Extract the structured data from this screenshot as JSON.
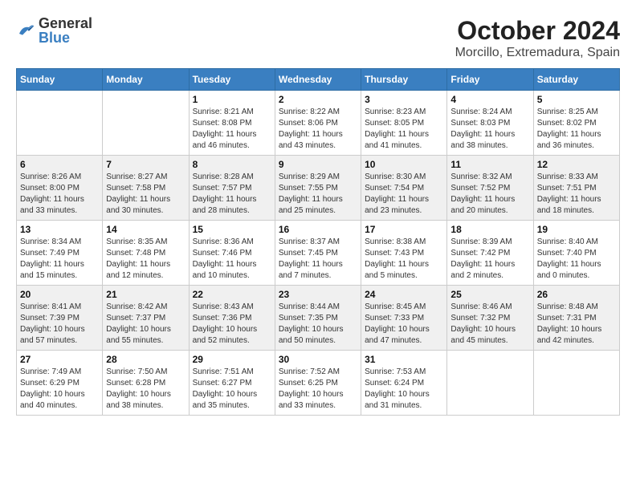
{
  "header": {
    "logo": {
      "general": "General",
      "blue": "Blue"
    },
    "title": "October 2024",
    "subtitle": "Morcillo, Extremadura, Spain"
  },
  "columns": [
    "Sunday",
    "Monday",
    "Tuesday",
    "Wednesday",
    "Thursday",
    "Friday",
    "Saturday"
  ],
  "weeks": [
    [
      {
        "day": "",
        "sunrise": "",
        "sunset": "",
        "daylight": ""
      },
      {
        "day": "",
        "sunrise": "",
        "sunset": "",
        "daylight": ""
      },
      {
        "day": "1",
        "sunrise": "Sunrise: 8:21 AM",
        "sunset": "Sunset: 8:08 PM",
        "daylight": "Daylight: 11 hours and 46 minutes."
      },
      {
        "day": "2",
        "sunrise": "Sunrise: 8:22 AM",
        "sunset": "Sunset: 8:06 PM",
        "daylight": "Daylight: 11 hours and 43 minutes."
      },
      {
        "day": "3",
        "sunrise": "Sunrise: 8:23 AM",
        "sunset": "Sunset: 8:05 PM",
        "daylight": "Daylight: 11 hours and 41 minutes."
      },
      {
        "day": "4",
        "sunrise": "Sunrise: 8:24 AM",
        "sunset": "Sunset: 8:03 PM",
        "daylight": "Daylight: 11 hours and 38 minutes."
      },
      {
        "day": "5",
        "sunrise": "Sunrise: 8:25 AM",
        "sunset": "Sunset: 8:02 PM",
        "daylight": "Daylight: 11 hours and 36 minutes."
      }
    ],
    [
      {
        "day": "6",
        "sunrise": "Sunrise: 8:26 AM",
        "sunset": "Sunset: 8:00 PM",
        "daylight": "Daylight: 11 hours and 33 minutes."
      },
      {
        "day": "7",
        "sunrise": "Sunrise: 8:27 AM",
        "sunset": "Sunset: 7:58 PM",
        "daylight": "Daylight: 11 hours and 30 minutes."
      },
      {
        "day": "8",
        "sunrise": "Sunrise: 8:28 AM",
        "sunset": "Sunset: 7:57 PM",
        "daylight": "Daylight: 11 hours and 28 minutes."
      },
      {
        "day": "9",
        "sunrise": "Sunrise: 8:29 AM",
        "sunset": "Sunset: 7:55 PM",
        "daylight": "Daylight: 11 hours and 25 minutes."
      },
      {
        "day": "10",
        "sunrise": "Sunrise: 8:30 AM",
        "sunset": "Sunset: 7:54 PM",
        "daylight": "Daylight: 11 hours and 23 minutes."
      },
      {
        "day": "11",
        "sunrise": "Sunrise: 8:32 AM",
        "sunset": "Sunset: 7:52 PM",
        "daylight": "Daylight: 11 hours and 20 minutes."
      },
      {
        "day": "12",
        "sunrise": "Sunrise: 8:33 AM",
        "sunset": "Sunset: 7:51 PM",
        "daylight": "Daylight: 11 hours and 18 minutes."
      }
    ],
    [
      {
        "day": "13",
        "sunrise": "Sunrise: 8:34 AM",
        "sunset": "Sunset: 7:49 PM",
        "daylight": "Daylight: 11 hours and 15 minutes."
      },
      {
        "day": "14",
        "sunrise": "Sunrise: 8:35 AM",
        "sunset": "Sunset: 7:48 PM",
        "daylight": "Daylight: 11 hours and 12 minutes."
      },
      {
        "day": "15",
        "sunrise": "Sunrise: 8:36 AM",
        "sunset": "Sunset: 7:46 PM",
        "daylight": "Daylight: 11 hours and 10 minutes."
      },
      {
        "day": "16",
        "sunrise": "Sunrise: 8:37 AM",
        "sunset": "Sunset: 7:45 PM",
        "daylight": "Daylight: 11 hours and 7 minutes."
      },
      {
        "day": "17",
        "sunrise": "Sunrise: 8:38 AM",
        "sunset": "Sunset: 7:43 PM",
        "daylight": "Daylight: 11 hours and 5 minutes."
      },
      {
        "day": "18",
        "sunrise": "Sunrise: 8:39 AM",
        "sunset": "Sunset: 7:42 PM",
        "daylight": "Daylight: 11 hours and 2 minutes."
      },
      {
        "day": "19",
        "sunrise": "Sunrise: 8:40 AM",
        "sunset": "Sunset: 7:40 PM",
        "daylight": "Daylight: 11 hours and 0 minutes."
      }
    ],
    [
      {
        "day": "20",
        "sunrise": "Sunrise: 8:41 AM",
        "sunset": "Sunset: 7:39 PM",
        "daylight": "Daylight: 10 hours and 57 minutes."
      },
      {
        "day": "21",
        "sunrise": "Sunrise: 8:42 AM",
        "sunset": "Sunset: 7:37 PM",
        "daylight": "Daylight: 10 hours and 55 minutes."
      },
      {
        "day": "22",
        "sunrise": "Sunrise: 8:43 AM",
        "sunset": "Sunset: 7:36 PM",
        "daylight": "Daylight: 10 hours and 52 minutes."
      },
      {
        "day": "23",
        "sunrise": "Sunrise: 8:44 AM",
        "sunset": "Sunset: 7:35 PM",
        "daylight": "Daylight: 10 hours and 50 minutes."
      },
      {
        "day": "24",
        "sunrise": "Sunrise: 8:45 AM",
        "sunset": "Sunset: 7:33 PM",
        "daylight": "Daylight: 10 hours and 47 minutes."
      },
      {
        "day": "25",
        "sunrise": "Sunrise: 8:46 AM",
        "sunset": "Sunset: 7:32 PM",
        "daylight": "Daylight: 10 hours and 45 minutes."
      },
      {
        "day": "26",
        "sunrise": "Sunrise: 8:48 AM",
        "sunset": "Sunset: 7:31 PM",
        "daylight": "Daylight: 10 hours and 42 minutes."
      }
    ],
    [
      {
        "day": "27",
        "sunrise": "Sunrise: 7:49 AM",
        "sunset": "Sunset: 6:29 PM",
        "daylight": "Daylight: 10 hours and 40 minutes."
      },
      {
        "day": "28",
        "sunrise": "Sunrise: 7:50 AM",
        "sunset": "Sunset: 6:28 PM",
        "daylight": "Daylight: 10 hours and 38 minutes."
      },
      {
        "day": "29",
        "sunrise": "Sunrise: 7:51 AM",
        "sunset": "Sunset: 6:27 PM",
        "daylight": "Daylight: 10 hours and 35 minutes."
      },
      {
        "day": "30",
        "sunrise": "Sunrise: 7:52 AM",
        "sunset": "Sunset: 6:25 PM",
        "daylight": "Daylight: 10 hours and 33 minutes."
      },
      {
        "day": "31",
        "sunrise": "Sunrise: 7:53 AM",
        "sunset": "Sunset: 6:24 PM",
        "daylight": "Daylight: 10 hours and 31 minutes."
      },
      {
        "day": "",
        "sunrise": "",
        "sunset": "",
        "daylight": ""
      },
      {
        "day": "",
        "sunrise": "",
        "sunset": "",
        "daylight": ""
      }
    ]
  ]
}
